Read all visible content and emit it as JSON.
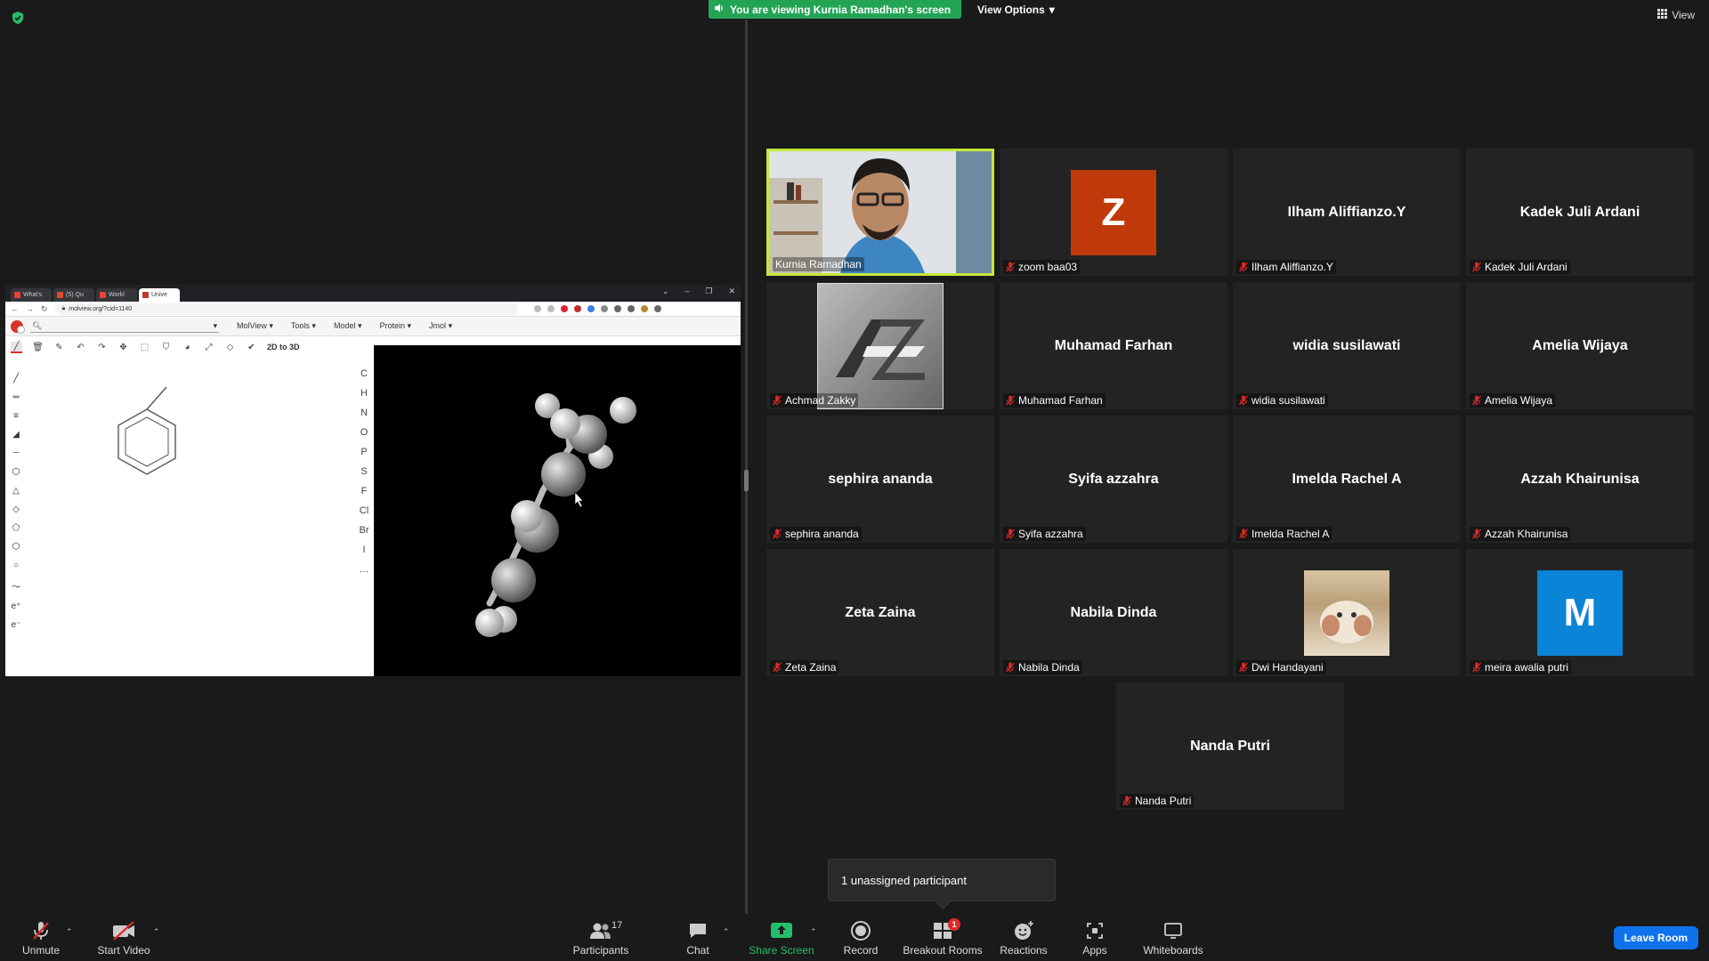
{
  "banner": {
    "text": "You are viewing Kurnia Ramadhan's screen"
  },
  "view_options": {
    "label": "View Options"
  },
  "view_button": {
    "label": "View"
  },
  "shared_screen": {
    "tabs": [
      "What's",
      "(5) Qu",
      "Workl",
      "Unive"
    ],
    "url": "molview.org/?cid=1140",
    "menu": [
      "MolView",
      "Tools",
      "Model",
      "Protein",
      "Jmol"
    ],
    "to3d": "2D to 3D",
    "elements": [
      "C",
      "H",
      "N",
      "O",
      "P",
      "S",
      "F",
      "Cl",
      "Br",
      "I",
      "…"
    ],
    "charges": [
      "e⁺",
      "e⁻"
    ]
  },
  "participants_grid": [
    {
      "name": "Kurnia Ramadhan",
      "label": "Kurnia Ramadhan",
      "kind": "video",
      "muted": false,
      "active": true
    },
    {
      "name": "zoom baa03",
      "label": "zoom baa03",
      "kind": "letter",
      "letter": "Z",
      "color": "#c0390b",
      "muted": true
    },
    {
      "name": "Ilham Aliffianzo.Y",
      "label": "Ilham Aliffianzo.Y",
      "kind": "text",
      "muted": true
    },
    {
      "name": "Kadek Juli Ardani",
      "label": "Kadek Juli Ardani",
      "kind": "text",
      "muted": true
    },
    {
      "name": "Achmad Zakky",
      "label": "Achmad Zakky",
      "kind": "logo",
      "muted": true
    },
    {
      "name": "Muhamad Farhan",
      "label": "Muhamad Farhan",
      "kind": "text",
      "muted": true
    },
    {
      "name": "widia susilawati",
      "label": "widia susilawati",
      "kind": "text",
      "muted": true
    },
    {
      "name": "Amelia Wijaya",
      "label": "Amelia Wijaya",
      "kind": "text",
      "muted": true
    },
    {
      "name": "sephira ananda",
      "label": "sephira ananda",
      "kind": "text",
      "muted": true
    },
    {
      "name": "Syifa azzahra",
      "label": "Syifa azzahra",
      "kind": "text",
      "muted": true
    },
    {
      "name": "Imelda Rachel A",
      "label": "Imelda Rachel A",
      "kind": "text",
      "muted": true
    },
    {
      "name": "Azzah Khairunisa",
      "label": "Azzah Khairunisa",
      "kind": "text",
      "muted": true
    },
    {
      "name": "Zeta Zaina",
      "label": "Zeta Zaina",
      "kind": "text",
      "muted": true
    },
    {
      "name": "Nabila Dinda",
      "label": "Nabila Dinda",
      "kind": "text",
      "muted": true
    },
    {
      "name": "Dwi Handayani",
      "label": "Dwi Handayani",
      "kind": "photo",
      "muted": true
    },
    {
      "name": "meira awalia putri",
      "label": "meira awalia putri",
      "kind": "letter",
      "letter": "M",
      "color": "#0a84d6",
      "muted": true
    },
    {
      "name": "Nanda Putri",
      "label": "Nanda Putri",
      "kind": "text",
      "muted": true
    }
  ],
  "tooltip": {
    "text": "1 unassigned participant"
  },
  "toolbar": {
    "unmute": "Unmute",
    "start_video": "Start Video",
    "participants": "Participants",
    "participants_count": "17",
    "chat": "Chat",
    "share_screen": "Share Screen",
    "record": "Record",
    "breakout_rooms": "Breakout Rooms",
    "breakout_badge": "1",
    "reactions": "Reactions",
    "apps": "Apps",
    "whiteboards": "Whiteboards",
    "leave": "Leave Room"
  },
  "colors": {
    "accent_green": "#23a455",
    "active_border": "#c6e83a",
    "leave_blue": "#0e72ed"
  }
}
